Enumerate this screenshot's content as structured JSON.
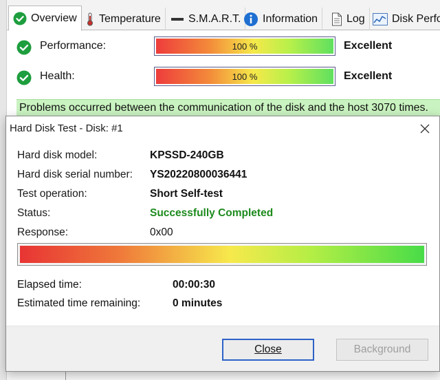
{
  "tabs": [
    {
      "label": "Overview",
      "icon": "check-circle-icon",
      "active": true
    },
    {
      "label": "Temperature",
      "icon": "thermometer-icon",
      "active": false
    },
    {
      "label": "S.M.A.R.T.",
      "icon": "smart-bar-icon",
      "active": false
    },
    {
      "label": "Information",
      "icon": "info-icon",
      "active": false
    },
    {
      "label": "Log",
      "icon": "document-icon",
      "active": false
    },
    {
      "label": "Disk Perfo",
      "icon": "chart-icon",
      "active": false
    }
  ],
  "overview": {
    "performance": {
      "label": "Performance:",
      "value_text": "100 %",
      "value": 100,
      "rating": "Excellent"
    },
    "health": {
      "label": "Health:",
      "value_text": "100 %",
      "value": 100,
      "rating": "Excellent"
    },
    "problem_message": "Problems occurred between the communication of the disk and the host 3070 times."
  },
  "dialog": {
    "title": "Hard Disk Test - Disk: #1",
    "model_label": "Hard disk model:",
    "model_value": "KPSSD-240GB",
    "serial_label": "Hard disk serial number:",
    "serial_value": "YS20220800036441",
    "operation_label": "Test operation:",
    "operation_value": "Short Self-test",
    "status_label": "Status:",
    "status_value": "Successfully Completed",
    "response_label": "Response:",
    "response_value": "0x00",
    "progress": 100,
    "elapsed_label": "Elapsed time:",
    "elapsed_value": "00:00:30",
    "remaining_label": "Estimated time remaining:",
    "remaining_value": "0 minutes",
    "close_button": "Close",
    "background_button": "Background"
  },
  "colors": {
    "status_success": "#1d8a1d",
    "banner_bg": "#c9f3c0",
    "focus_border": "#2d62c7",
    "check_green": "#1e9e3e"
  }
}
